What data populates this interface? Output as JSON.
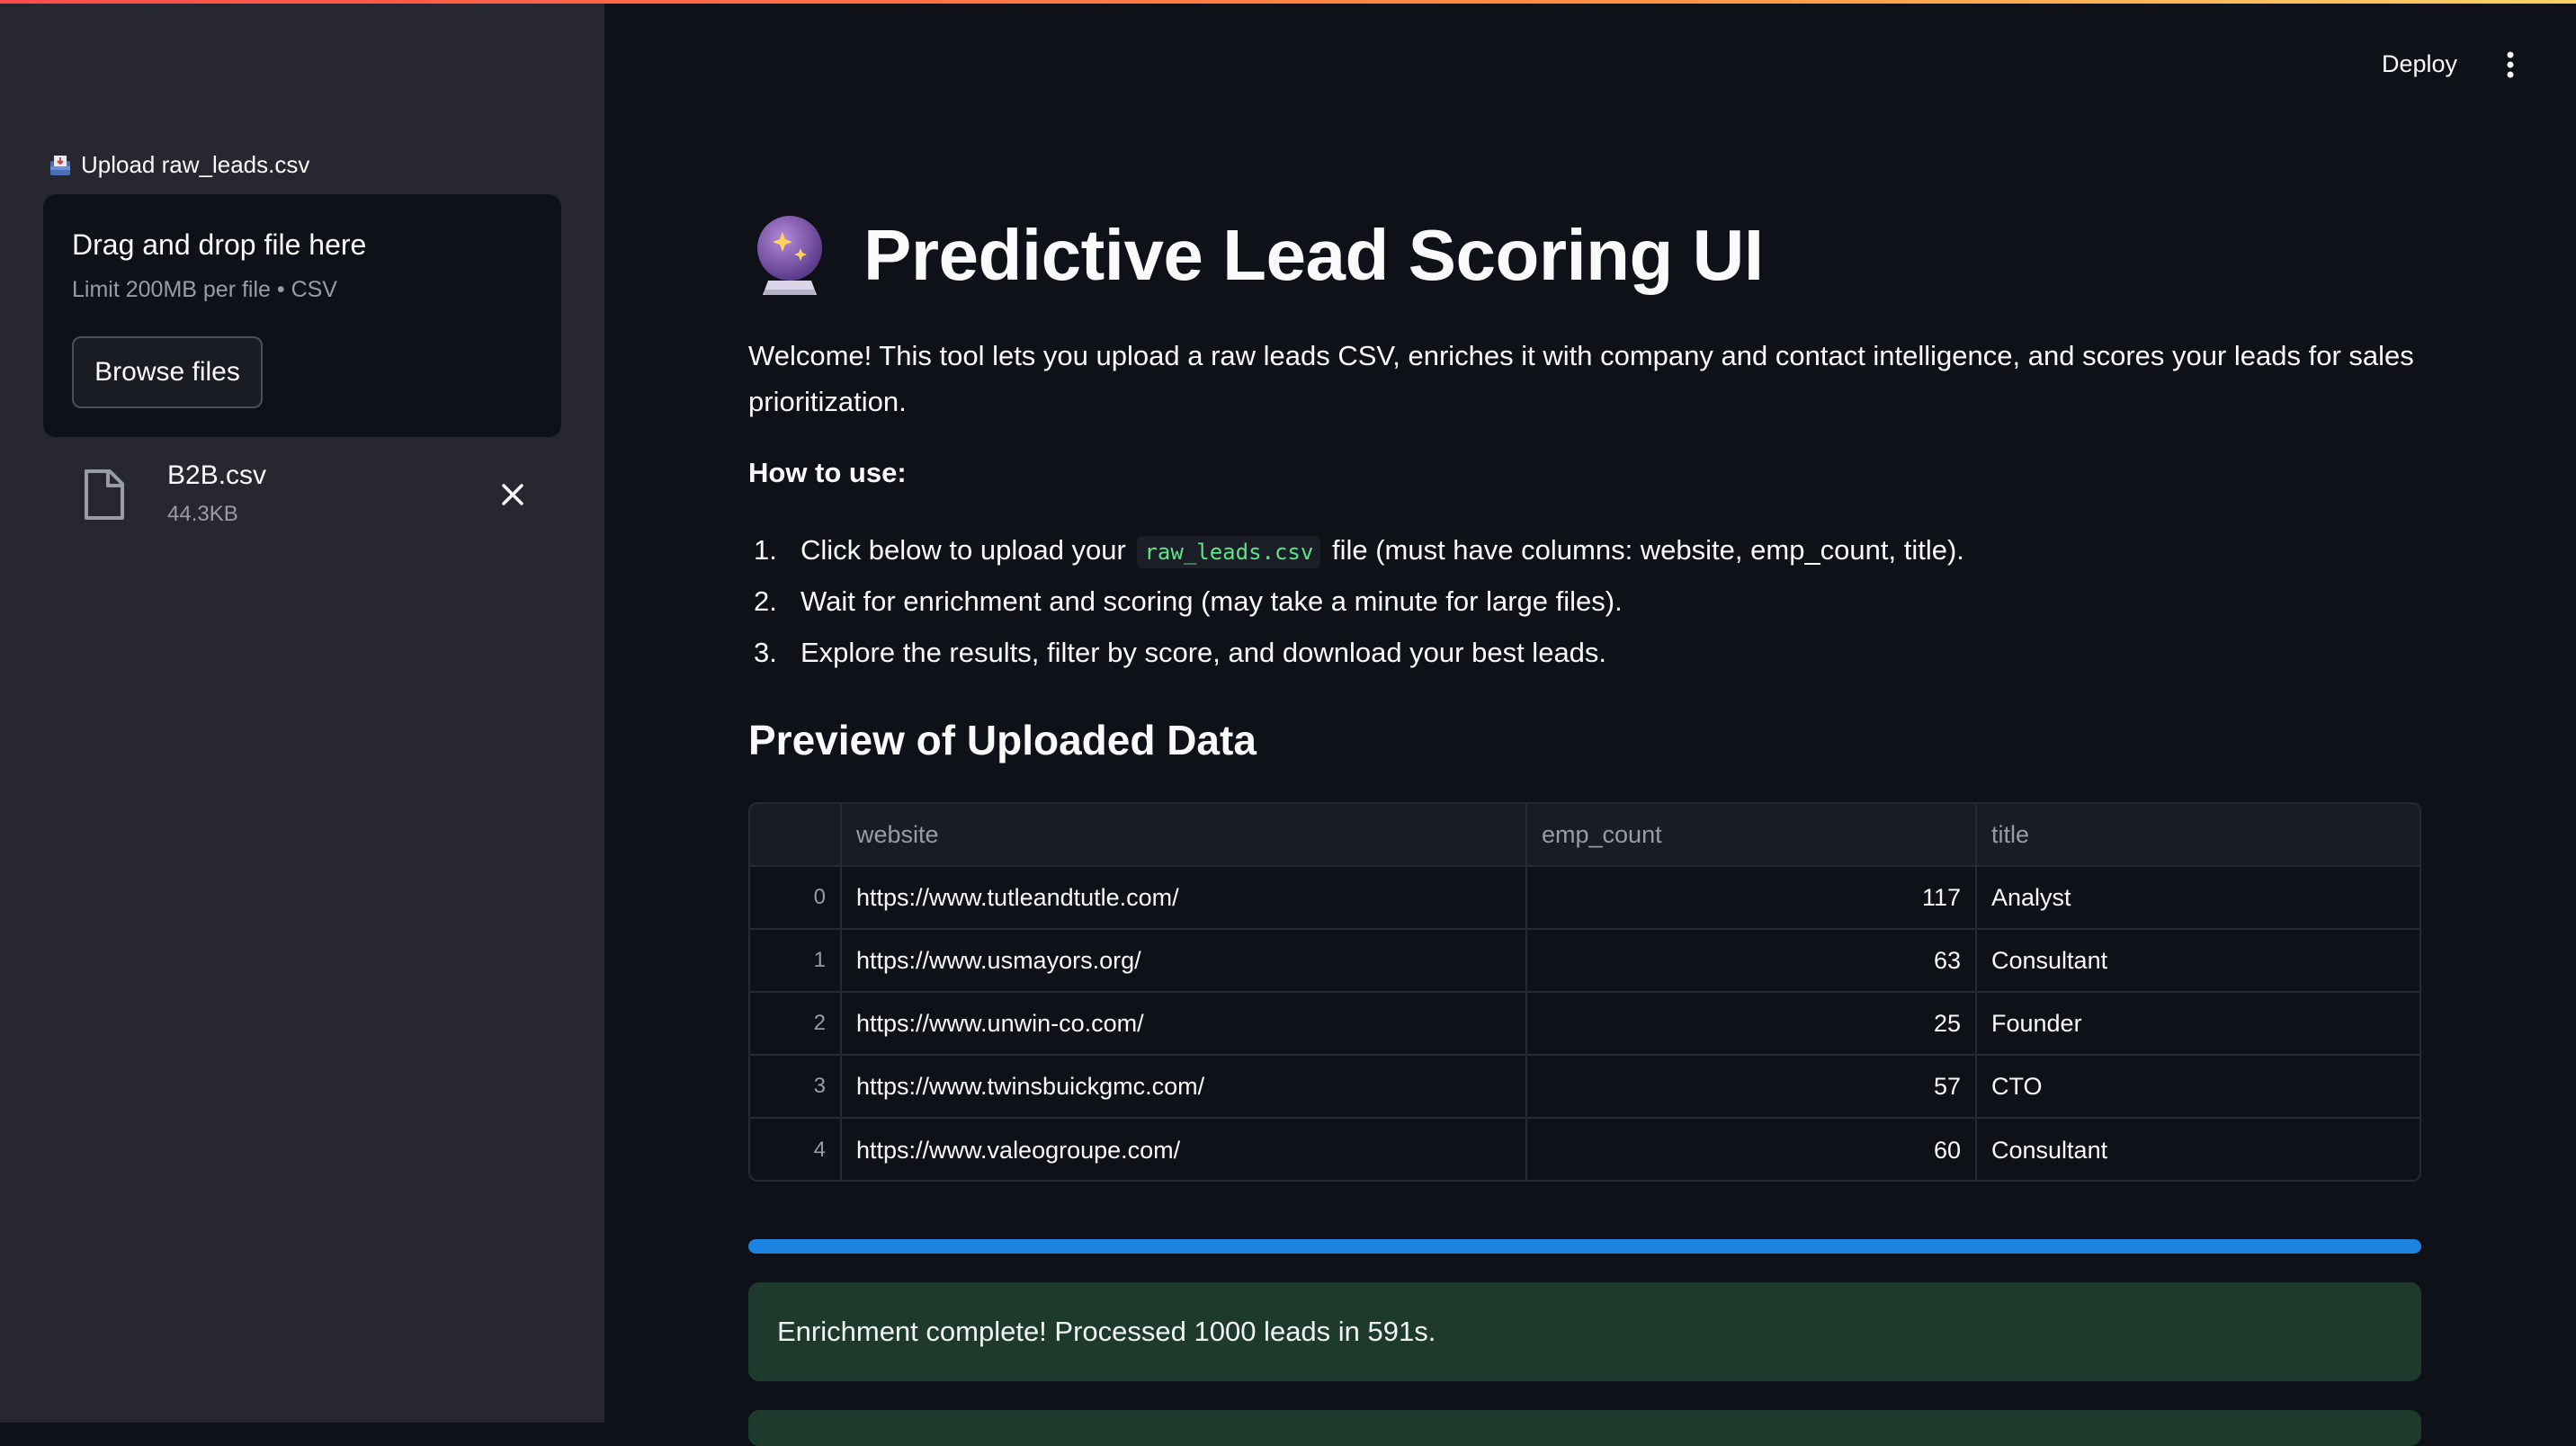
{
  "sidebar": {
    "upload_label": "Upload raw_leads.csv",
    "dropzone": {
      "title": "Drag and drop file here",
      "limit": "Limit 200MB per file • CSV",
      "browse_label": "Browse files"
    },
    "file": {
      "name": "B2B.csv",
      "size": "44.3KB"
    }
  },
  "header": {
    "deploy_label": "Deploy"
  },
  "main": {
    "title": "Predictive Lead Scoring UI",
    "intro": "Welcome! This tool lets you upload a raw leads CSV, enriches it with company and contact intelligence, and scores your leads for sales prioritization.",
    "howto_label": "How to use:",
    "steps": [
      {
        "num": "1.",
        "before": "Click below to upload your",
        "code": "raw_leads.csv",
        "after": "file (must have columns: website, emp_count, title)."
      },
      {
        "num": "2.",
        "text": "Wait for enrichment and scoring (may take a minute for large files)."
      },
      {
        "num": "3.",
        "text": "Explore the results, filter by score, and download your best leads."
      }
    ],
    "preview_heading": "Preview of Uploaded Data",
    "table": {
      "columns": [
        "",
        "website",
        "emp_count",
        "title"
      ],
      "rows": [
        [
          "0",
          "https://www.tutleandtutle.com/",
          "117",
          "Analyst"
        ],
        [
          "1",
          "https://www.usmayors.org/",
          "63",
          "Consultant"
        ],
        [
          "2",
          "https://www.unwin-co.com/",
          "25",
          "Founder"
        ],
        [
          "3",
          "https://www.twinsbuickgmc.com/",
          "57",
          "CTO"
        ],
        [
          "4",
          "https://www.valeogroupe.com/",
          "60",
          "Consultant"
        ]
      ]
    },
    "progress": 1.0,
    "success_message": "Enrichment complete! Processed 1000 leads in 591s."
  },
  "colors": {
    "accent_gradient": [
      "#ff4b4b",
      "#ffd166"
    ],
    "progress": "#1c83e1",
    "success_bg": "#1e3a2d",
    "code_text": "#5ce488"
  }
}
